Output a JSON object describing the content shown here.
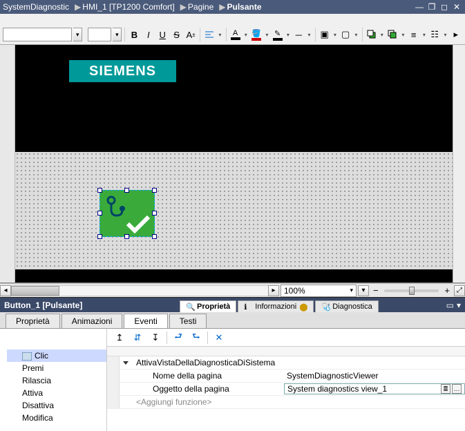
{
  "breadcrumb": [
    "SystemDiagnostic",
    "HMI_1 [TP1200 Comfort]",
    "Pagine",
    "Pulsante"
  ],
  "logo_text": "SIEMENS",
  "zoom": {
    "value": "100%"
  },
  "section_title": "Button_1 [Pulsante]",
  "prop_tabs": {
    "proprieta": "Proprietà",
    "informazioni": "Informazioni",
    "diagnostica": "Diagnostica"
  },
  "inner_tabs": {
    "proprieta": "Proprietà",
    "animazioni": "Animazioni",
    "eventi": "Eventi",
    "testi": "Testi"
  },
  "events": {
    "list": {
      "clic": "Clic",
      "premi": "Premi",
      "rilascia": "Rilascia",
      "attiva": "Attiva",
      "disattiva": "Disattiva",
      "modifica": "Modifica"
    },
    "grid": {
      "func_name": "AttivaVistaDellaDiagnosticaDiSistema",
      "param1_label": "Nome della pagina",
      "param1_value": "SystemDiagnosticViewer",
      "param2_label": "Oggetto della pagina",
      "param2_value": "System diagnostics view_1",
      "add_label": "<Aggiungi funzione>"
    }
  }
}
